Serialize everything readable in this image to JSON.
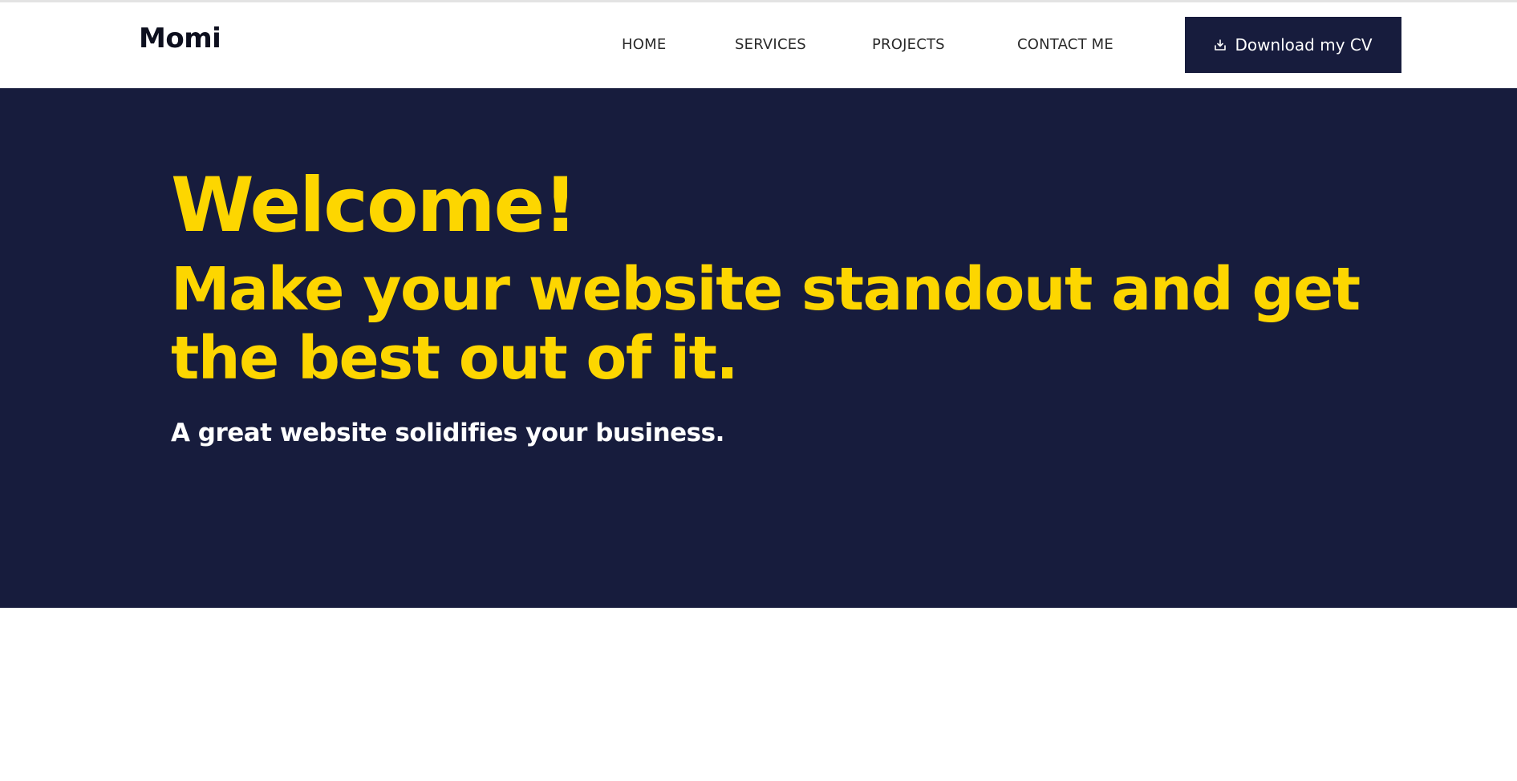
{
  "header": {
    "logo": "Momi",
    "nav": [
      {
        "label": "HOME"
      },
      {
        "label": "SERVICES"
      },
      {
        "label": "PROJECTS"
      },
      {
        "label": "CONTACT ME"
      }
    ],
    "cv_button": {
      "label": "Download my CV",
      "icon": "download-icon"
    }
  },
  "hero": {
    "welcome": "Welcome!",
    "tagline": "Make your website standout and get the best out of it.",
    "subtitle": "A great website solidifies your business."
  },
  "colors": {
    "navy": "#171c3d",
    "accent_yellow": "#fdd600",
    "white": "#ffffff",
    "text_dark": "#0d0f1e"
  }
}
